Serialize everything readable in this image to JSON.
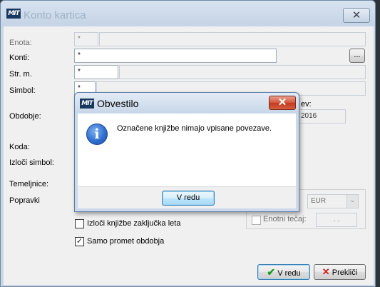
{
  "main_window": {
    "title": "Konto kartica",
    "logo_text": "MIT",
    "close_glyph": "✕"
  },
  "form": {
    "enota": {
      "label": "Enota:",
      "value": "*"
    },
    "konti": {
      "label": "Konti:",
      "value": "*",
      "browse_label": "..."
    },
    "strm": {
      "label": "Str. m.",
      "value": "*"
    },
    "simbol": {
      "label": "Simbol:",
      "value": "*"
    },
    "obdobje": {
      "label": "Obdobje:",
      "partial_label": "ev:",
      "date_fragment": "2016"
    },
    "koda": {
      "label": "Koda:"
    },
    "izloci_simbol": {
      "label": "Izloči simbol:"
    },
    "temeljnice": {
      "label": "Temeljnice:"
    },
    "popravki": {
      "label": "Popravki"
    },
    "currency": {
      "value": "EUR"
    },
    "enotni_tecaj": {
      "label": "Enotni tečaj:",
      "value": ". ."
    },
    "check_zakljucka": {
      "label": "Izloči knjižbe zaključka leta",
      "checked": false
    },
    "check_promet": {
      "label": "Samo promet obdobja",
      "checked": true
    },
    "ok_button": {
      "label": "V redu",
      "icon": "green-check-icon"
    },
    "cancel_button": {
      "label": "Prekliči",
      "icon": "red-x-icon"
    }
  },
  "dialog": {
    "title": "Obvestilo",
    "logo_text": "MIT",
    "message": "Označene knjižbe nimajo vpisane povezave.",
    "ok_label": "V redu",
    "icon": "info-icon",
    "close_glyph": "✕"
  },
  "colors": {
    "dialog_close": "#c23a1f",
    "info_icon": "#2f6fd0",
    "window_frame": "#c9d6e6"
  }
}
